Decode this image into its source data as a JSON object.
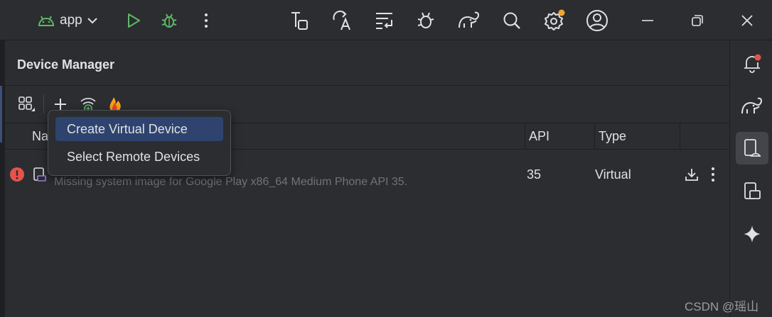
{
  "toolbar": {
    "app_label": "app",
    "icons": [
      "android-icon",
      "chevron-down-icon",
      "run-icon",
      "debug-icon",
      "more-vert-icon",
      "build-icon",
      "translate-icon",
      "logcat-icon",
      "bug-settings-icon",
      "gradle-icon",
      "search-icon",
      "settings-icon",
      "account-icon",
      "minimize-icon",
      "restore-icon",
      "close-icon"
    ]
  },
  "device_manager": {
    "title": "Device Manager",
    "tools": [
      "layout-grid-icon",
      "add-icon",
      "wifi-pair-icon",
      "firebase-icon"
    ],
    "columns": {
      "name": "Na",
      "api": "API",
      "type": "Type"
    },
    "rows": [
      {
        "status": "error",
        "subtext": "Missing system image for Google Play x86_64 Medium Phone API 35.",
        "api": "35",
        "type": "Virtual"
      }
    ]
  },
  "popup_menu": {
    "items": [
      {
        "label": "Create Virtual Device",
        "selected": true
      },
      {
        "label": "Select Remote Devices",
        "selected": false
      }
    ]
  },
  "right_strip": {
    "icons": [
      "notifications-icon",
      "gradle-icon",
      "device-manager-icon",
      "running-devices-icon",
      "gemini-icon"
    ],
    "active": "device-manager-icon"
  },
  "watermark": "CSDN @瑶山",
  "colors": {
    "accent_green": "#5fb865",
    "error_red": "#e5534b",
    "selection_blue": "#2e436e",
    "background": "#2b2d30",
    "notification_badge": "#f0a732"
  }
}
